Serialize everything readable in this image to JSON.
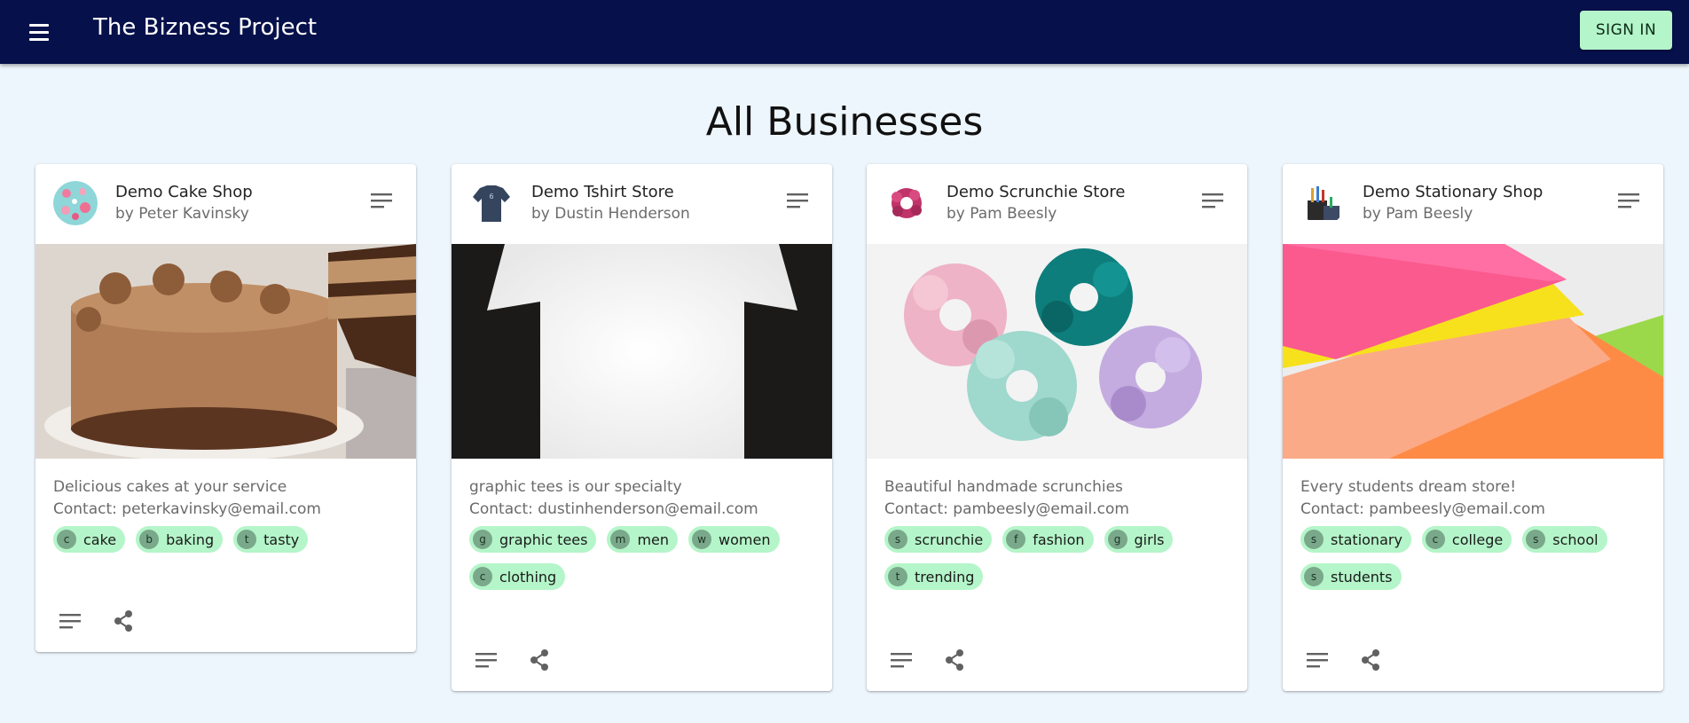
{
  "app": {
    "title": "The Bizness Project",
    "signin_label": "SIGN IN"
  },
  "page": {
    "heading": "All Businesses"
  },
  "colors": {
    "appbar": "#06104a",
    "background": "#eef6fd",
    "accent": "#b4f5c9",
    "chip_avatar": "#7aa88a"
  },
  "icons": {
    "menu": "hamburger-icon",
    "card_menu": "notes-icon",
    "notes": "notes-icon",
    "share": "share-icon"
  },
  "businesses": [
    {
      "name": "Demo Cake Shop",
      "owner": "by Peter Kavinsky",
      "description": "Delicious cakes at your service",
      "contact": "Contact: peterkavinsky@email.com",
      "tags": [
        {
          "letter": "c",
          "label": "cake"
        },
        {
          "letter": "b",
          "label": "baking"
        },
        {
          "letter": "t",
          "label": "tasty"
        }
      ]
    },
    {
      "name": "Demo Tshirt Store",
      "owner": "by Dustin Henderson",
      "description": "graphic tees is our specialty",
      "contact": "Contact: dustinhenderson@email.com",
      "tags": [
        {
          "letter": "g",
          "label": "graphic tees"
        },
        {
          "letter": "m",
          "label": "men"
        },
        {
          "letter": "w",
          "label": "women"
        },
        {
          "letter": "c",
          "label": "clothing"
        }
      ]
    },
    {
      "name": "Demo Scrunchie Store",
      "owner": "by Pam Beesly",
      "description": "Beautiful handmade scrunchies",
      "contact": "Contact: pambeesly@email.com",
      "tags": [
        {
          "letter": "s",
          "label": "scrunchie"
        },
        {
          "letter": "f",
          "label": "fashion"
        },
        {
          "letter": "g",
          "label": "girls"
        },
        {
          "letter": "t",
          "label": "trending"
        }
      ]
    },
    {
      "name": "Demo Stationary Shop",
      "owner": "by Pam Beesly",
      "description": "Every students dream store!",
      "contact": "Contact: pambeesly@email.com",
      "tags": [
        {
          "letter": "s",
          "label": "stationary"
        },
        {
          "letter": "c",
          "label": "college"
        },
        {
          "letter": "s",
          "label": "school"
        },
        {
          "letter": "s",
          "label": "students"
        }
      ]
    }
  ]
}
